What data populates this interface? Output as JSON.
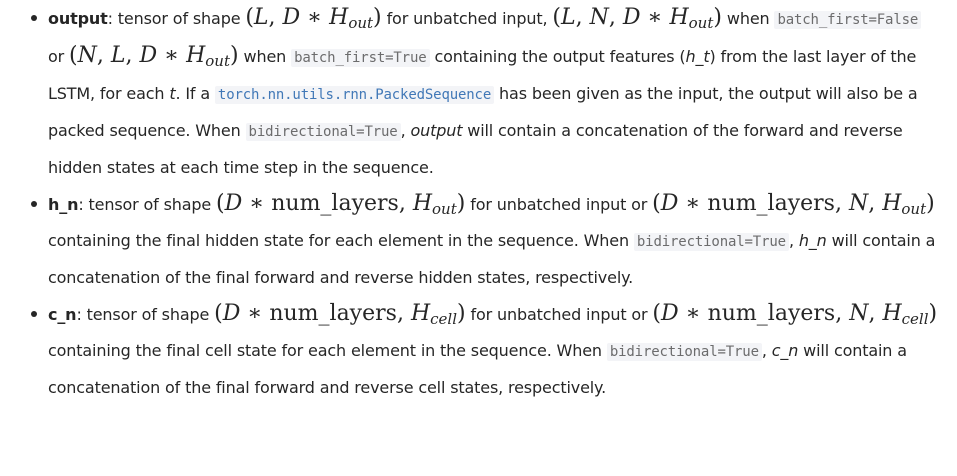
{
  "items": [
    {
      "term": "output",
      "colon": ": tensor of shape ",
      "math1": {
        "open": "(",
        "a": "L",
        "c1": ", ",
        "b": "D",
        "op": " ∗ ",
        "h": "H",
        "sub": "out",
        "close": ")"
      },
      "t1": " for unbatched input, ",
      "math2": {
        "open": "(",
        "a": "L",
        "c1": ", ",
        "n": "N",
        "c2": ", ",
        "b": "D",
        "op": " ∗ ",
        "h": "H",
        "sub": "out",
        "close": ")"
      },
      "t2": " when ",
      "code1": "batch_first=False",
      "t3": " or ",
      "math3": {
        "open": "(",
        "n": "N",
        "c1": ", ",
        "a": "L",
        "c2": ", ",
        "b": "D",
        "op": " ∗ ",
        "h": "H",
        "sub": "out",
        "close": ")"
      },
      "t4": " when ",
      "code2": "batch_first=True",
      "t5": " containing the output features (",
      "it1": "h_t",
      "t6": ") from the last layer of the LSTM, for each ",
      "it2": "t",
      "t7": ". If a ",
      "code3": "torch.nn.utils.rnn.PackedSequence",
      "t8": " has been given as the input, the output will also be a packed sequence. When ",
      "code4": "bidirectional=True",
      "t9": ", ",
      "it3": "output",
      "t10": " will contain a concatenation of the forward and reverse hidden states at each time step in the sequence."
    },
    {
      "term": "h_n",
      "colon": ": tensor of shape ",
      "math1": {
        "open": "(",
        "b": "D",
        "op": " ∗ ",
        "word": "num_layers",
        "c1": ", ",
        "h": "H",
        "sub": "out",
        "close": ")"
      },
      "t1": " for unbatched input or ",
      "math2": {
        "open": "(",
        "b": "D",
        "op": " ∗ ",
        "word": "num_layers",
        "c1": ", ",
        "n": "N",
        "c2": ", ",
        "h": "H",
        "sub": "out",
        "close": ")"
      },
      "t2": " containing the final hidden state for each element in the sequence. When ",
      "code1": "bidirectional=True",
      "t3": ", ",
      "it1": "h_n",
      "t4": " will contain a concatenation of the final forward and reverse hidden states, respectively."
    },
    {
      "term": "c_n",
      "colon": ": tensor of shape ",
      "math1": {
        "open": "(",
        "b": "D",
        "op": " ∗ ",
        "word": "num_layers",
        "c1": ", ",
        "h": "H",
        "sub": "cell",
        "close": ")"
      },
      "t1": " for unbatched input or ",
      "math2": {
        "open": "(",
        "b": "D",
        "op": " ∗ ",
        "word": "num_layers",
        "c1": ", ",
        "n": "N",
        "c2": ", ",
        "h": "H",
        "sub": "cell",
        "close": ")"
      },
      "t2": " containing the final cell state for each element in the sequence. When ",
      "code1": "bidirectional=True",
      "t3": ", ",
      "it1": "c_n",
      "t4": " will contain a concatenation of the final forward and reverse cell states, respectively."
    }
  ]
}
